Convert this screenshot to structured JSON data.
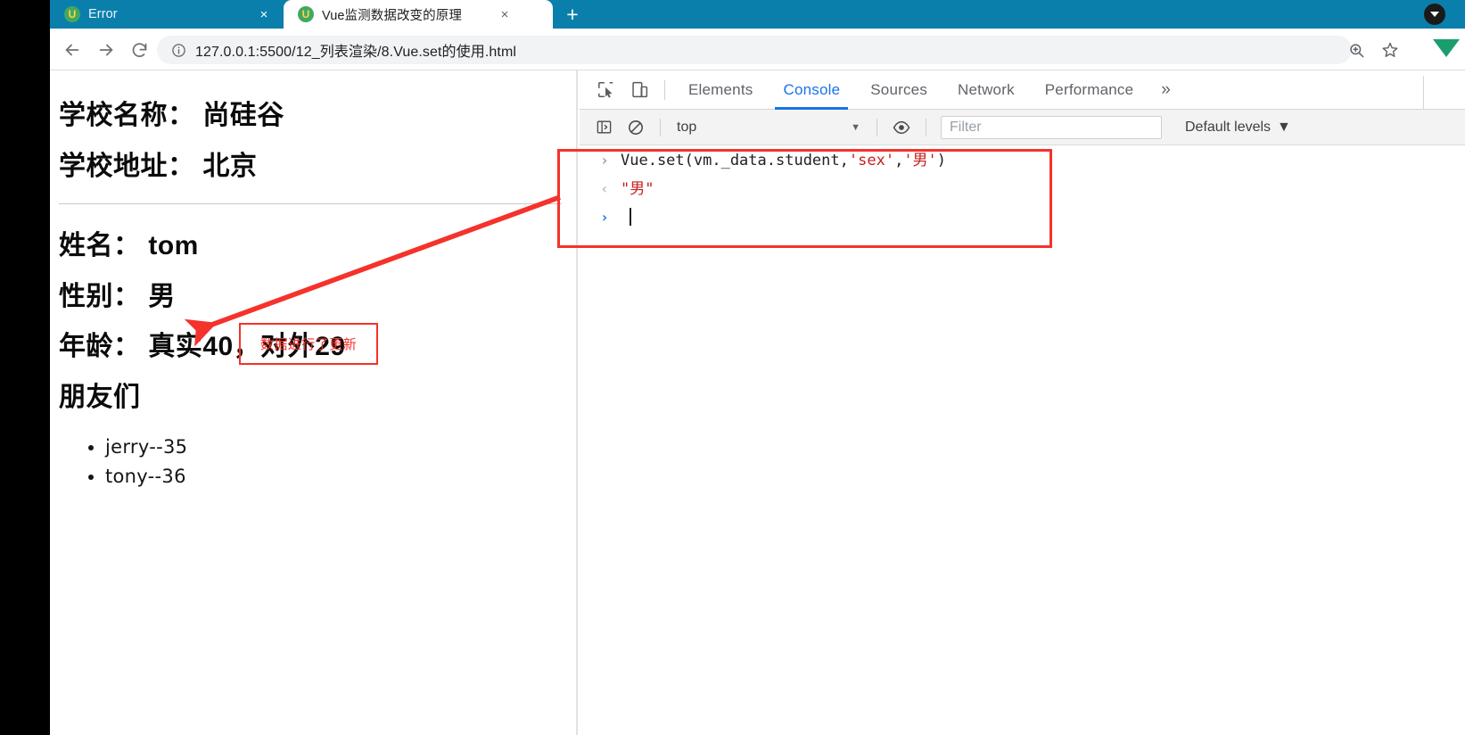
{
  "browser": {
    "tabs": [
      {
        "title": "Error",
        "favicon": "vue-logo-icon",
        "active": false,
        "close_label": "×"
      },
      {
        "title": "Vue监测数据改变的原理",
        "favicon": "vue-logo-icon",
        "active": true,
        "close_label": "×"
      }
    ],
    "new_tab_label": "+",
    "toolbar": {
      "back_label": "←",
      "forward_label": "→",
      "reload_label": "⟳",
      "site_info_label": "ⓘ",
      "url": "127.0.0.1:5500/12_列表渲染/8.Vue.set的使用.html",
      "zoom_icon": "zoom-in-icon",
      "bookmark_icon": "star-icon"
    },
    "accent_color": "#0b7fab"
  },
  "page": {
    "headings": [
      "学校名称： 尚硅谷",
      "学校地址： 北京"
    ],
    "student": [
      "姓名： tom",
      "性别： 男",
      "年龄： 真实40，对外29"
    ],
    "friends_heading": "朋友们",
    "friends": [
      "jerry--35",
      "tony--36"
    ]
  },
  "annotations": {
    "box_text": "数据进行了更新",
    "color": "#f5322c"
  },
  "devtools": {
    "inspect_icon": "inspect-element-icon",
    "device_icon": "device-toolbar-icon",
    "tabs": [
      {
        "label": "Elements",
        "active": false
      },
      {
        "label": "Console",
        "active": true
      },
      {
        "label": "Sources",
        "active": false
      },
      {
        "label": "Network",
        "active": false
      },
      {
        "label": "Performance",
        "active": false
      }
    ],
    "more_tabs_label": "»",
    "console_toolbar": {
      "sidebar_icon": "console-sidebar-icon",
      "clear_icon": "clear-console-icon",
      "context": "top",
      "context_caret": "▼",
      "eye_icon": "live-expression-icon",
      "filter_placeholder": "Filter",
      "filter_value": "",
      "levels_label": "Default levels",
      "levels_caret": "▼"
    },
    "console_messages": [
      {
        "type": "input",
        "gutter": "›",
        "prefix": "Vue.set(vm._data.student,",
        "arg1": "'sex'",
        "comma": ",",
        "arg2": "'男'",
        "suffix": ")"
      },
      {
        "type": "output",
        "gutter": "‹",
        "value": "\"男\""
      },
      {
        "type": "prompt",
        "gutter": "›",
        "value": ""
      }
    ]
  }
}
